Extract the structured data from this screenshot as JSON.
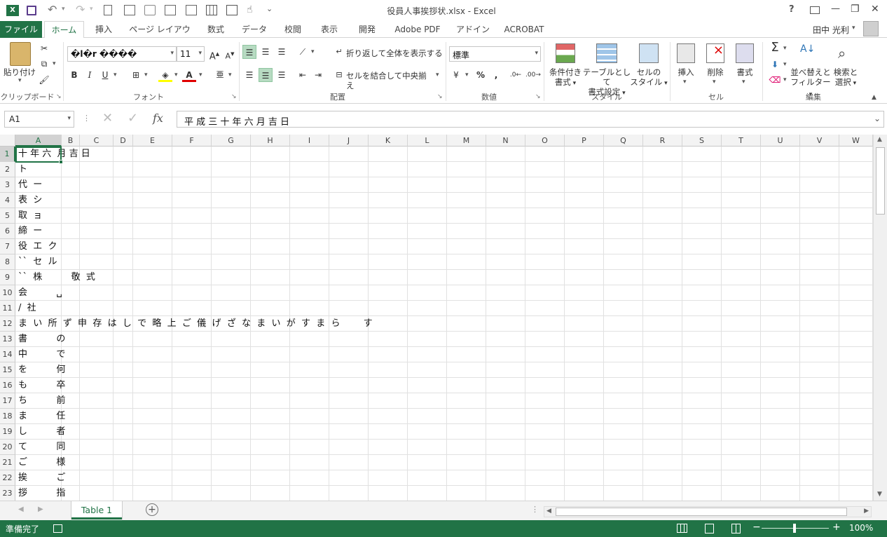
{
  "window": {
    "title": "役員人事挨拶状.xlsx - Excel",
    "help": "?",
    "minimize": "—",
    "restore": "❐",
    "close": "✕"
  },
  "qat": {
    "more": "⌄"
  },
  "tabs": [
    "ファイル",
    "ホーム",
    "挿入",
    "ページ レイアウト",
    "数式",
    "データ",
    "校閲",
    "表示",
    "開発",
    "Adobe PDF",
    "アドイン",
    "ACROBAT"
  ],
  "user": {
    "name": "田中 光利"
  },
  "ribbon": {
    "clipboard": {
      "paste": "貼り付け",
      "label": "クリップボード"
    },
    "font": {
      "name": "�l�r ����",
      "size": "11",
      "bold": "B",
      "italic": "I",
      "underline": "U",
      "label": "フォント"
    },
    "alignment": {
      "wrap": "折り返して全体を表示する",
      "merge": "セルを結合して中央揃え",
      "label": "配置"
    },
    "number": {
      "format": "標準",
      "percent": "%",
      "comma": ",",
      "label": "数値"
    },
    "styles": {
      "conditional": [
        "条件付き",
        "書式"
      ],
      "table": [
        "テーブルとして",
        "書式設定"
      ],
      "cell": [
        "セルの",
        "スタイル"
      ],
      "label": "スタイル"
    },
    "cells": {
      "insert": "挿入",
      "delete": "削除",
      "format": "書式",
      "label": "セル"
    },
    "editing": {
      "sort": [
        "並べ替えと",
        "フィルター"
      ],
      "find": [
        "検索と",
        "選択"
      ],
      "label": "編集"
    }
  },
  "formula_bar": {
    "namebox": "A1",
    "fx": "fx",
    "content": "平 成 三 十 年 六 月 吉 日"
  },
  "columns": [
    "A",
    "B",
    "C",
    "D",
    "E",
    "F",
    "G",
    "H",
    "I",
    "J",
    "K",
    "L",
    "M",
    "N",
    "O",
    "P",
    "Q",
    "R",
    "S",
    "T",
    "U",
    "V",
    "W"
  ],
  "rows": [
    "1",
    "2",
    "3",
    "4",
    "5",
    "6",
    "7",
    "8",
    "9",
    "10",
    "11",
    "12",
    "13",
    "14",
    "15",
    "16",
    "17",
    "18",
    "19",
    "20",
    "21",
    "22",
    "23"
  ],
  "cells": [
    "十 年 六  月 吉 日",
    "ト",
    "代  ー",
    "表  シ",
    "取  ョ",
    "締  ー",
    "役  エ  ク",
    "``  セ  ル",
    "``  株          敬  式",
    "会          ␣",
    "/  社",
    "ま  い  所  ず  申  存  は  し  で  略  上  ご  儀  げ  ざ  な  ま  い  が  す  ま  ら        す",
    "書          の",
    "中          で",
    "を          何",
    "も          卒",
    "ち          前",
    "ま          任",
    "し          者",
    "て          同",
    "ご          様",
    "挨          ご",
    "拶          指"
  ],
  "sheet": {
    "tab": "Table 1",
    "add": "+"
  },
  "status": {
    "text": "準備完了",
    "zoom": "100%"
  },
  "colors": {
    "accent": "#217346"
  }
}
